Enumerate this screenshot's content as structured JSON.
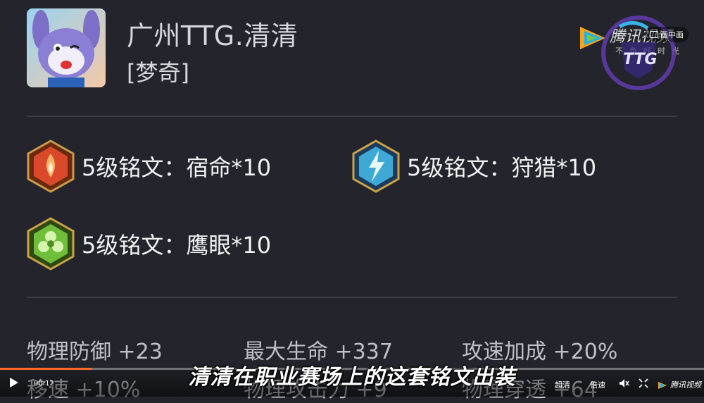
{
  "header": {
    "player_name": "广州TTG.清清",
    "hero_name": "[梦奇]"
  },
  "runes": [
    {
      "label": "5级铭文：宿命*10",
      "icon": "red-flame-rune-icon",
      "color": "#d9492a"
    },
    {
      "label": "5级铭文：狩猎*10",
      "icon": "blue-lightning-rune-icon",
      "color": "#3fa9d6"
    },
    {
      "label": "5级铭文：鹰眼*10",
      "icon": "green-clover-rune-icon",
      "color": "#6fbf3a"
    }
  ],
  "stats": {
    "row1": [
      "物理防御 +23",
      "最大生命 +337",
      "攻速加成 +20%"
    ],
    "row2": [
      "移速 +10%",
      "物理攻击力 +9",
      "物理穿透 +64"
    ]
  },
  "subtitle": "清清在职业赛场上的这套铭文出装",
  "watermark": {
    "brand": "腾讯视频",
    "slogan": "不负好时光",
    "pip_label": "画中画",
    "team_logo_text": "TTG"
  },
  "player_controls": {
    "time": "00:12",
    "progress": 0.13,
    "quality_label": "超清",
    "speed_label": "倍速",
    "brand_label": "腾讯视频"
  }
}
